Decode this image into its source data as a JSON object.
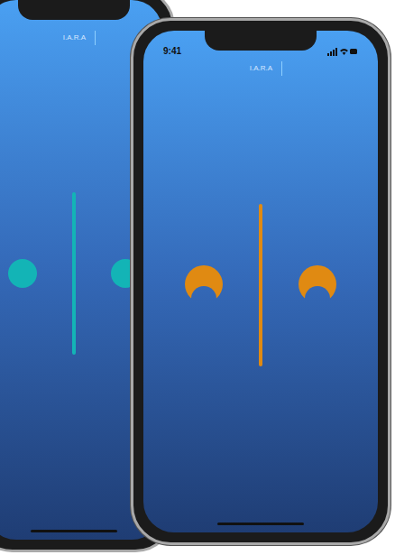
{
  "phones": [
    {
      "name": "back",
      "title": "I.A.R.A",
      "kind": "circle",
      "color": "#13b4b6"
    },
    {
      "name": "front",
      "title": "I.A.R.A",
      "time": "9:41",
      "kind": "crescent",
      "color": "#e08a12"
    }
  ]
}
